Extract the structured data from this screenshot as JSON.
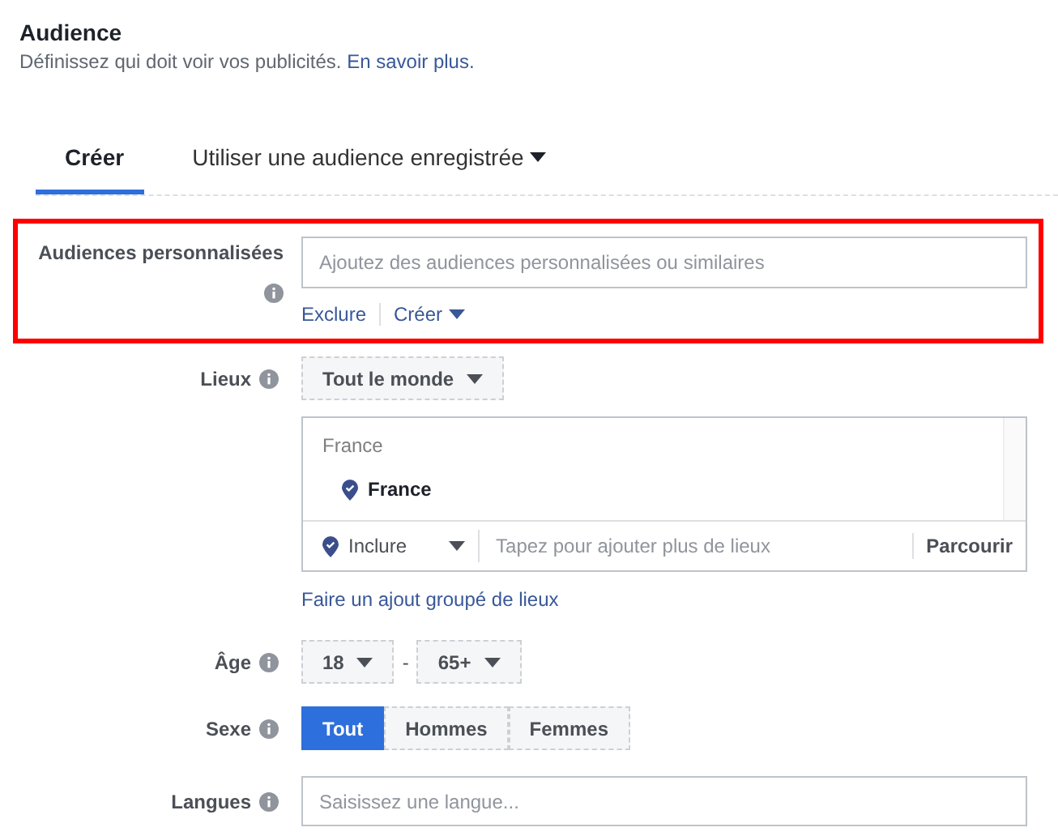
{
  "header": {
    "title": "Audience",
    "description": "Définissez qui doit voir vos publicités.",
    "link": "En savoir plus."
  },
  "tabs": [
    {
      "label": "Créer",
      "selected": true,
      "dropdown": false
    },
    {
      "label": "Utiliser une audience enregistrée",
      "selected": false,
      "dropdown": true
    }
  ],
  "custom_audiences": {
    "label": "Audiences personnalisées",
    "placeholder": "Ajoutez des audiences personnalisées ou similaires",
    "highlighted": true,
    "exclude_link": "Exclure",
    "create_link": "Créer"
  },
  "locations": {
    "label": "Lieux",
    "scope": "Tout le monde",
    "group_title": "France",
    "items": [
      "France"
    ],
    "mode": "Inclure",
    "placeholder": "Tapez pour ajouter plus de lieux",
    "browse": "Parcourir",
    "bulk_link": "Faire un ajout groupé de lieux"
  },
  "age": {
    "label": "Âge",
    "min": "18",
    "separator": "-",
    "max": "65+"
  },
  "gender": {
    "label": "Sexe",
    "options": [
      {
        "label": "Tout",
        "selected": true
      },
      {
        "label": "Hommes",
        "selected": false
      },
      {
        "label": "Femmes",
        "selected": false
      }
    ]
  },
  "languages": {
    "label": "Langues",
    "placeholder": "Saisissez une langue..."
  }
}
